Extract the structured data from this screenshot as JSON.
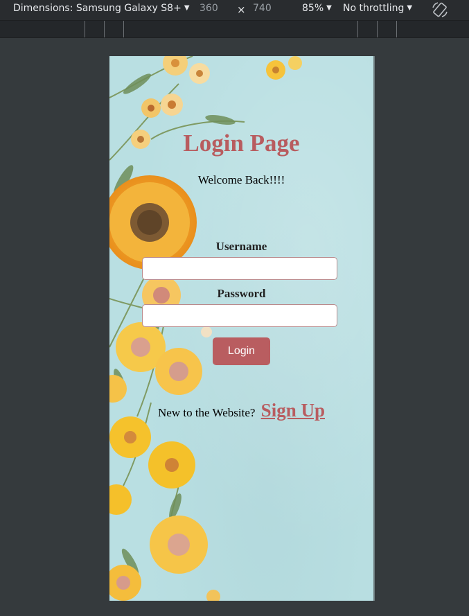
{
  "devtools": {
    "dimensions_label": "Dimensions: Samsung Galaxy S8+",
    "width": "360",
    "times": "×",
    "height": "740",
    "zoom": "85%",
    "throttling": "No throttling"
  },
  "page": {
    "title": "Login Page",
    "welcome": "Welcome Back!!!!",
    "username_label": "Username",
    "username_value": "",
    "password_label": "Password",
    "password_value": "",
    "login_button": "Login",
    "signup_prompt": "New to the Website?",
    "signup_link": "Sign Up"
  },
  "colors": {
    "accent": "#b85c5f",
    "background": "#b9dfe2",
    "devtools_bg": "#292c2f"
  }
}
